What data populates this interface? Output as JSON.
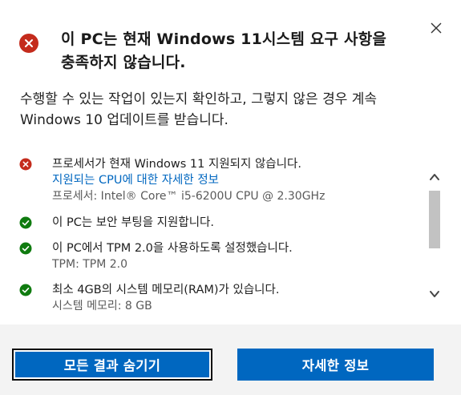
{
  "dialog": {
    "title": "이 PC는 현재 Windows 11시스템 요구 사항을 충족하지 않습니다.",
    "description": "수행할 수 있는 작업이 있는지 확인하고, 그렇지 않은 경우 계속 Windows 10 업데이트를 받습니다."
  },
  "checks": [
    {
      "status": "fail",
      "title": "프로세서가 현재 Windows 11 지원되지 않습니다.",
      "link": "지원되는 CPU에 대한 자세한 정보",
      "detail": "프로세서: Intel® Core™ i5-6200U CPU @ 2.30GHz"
    },
    {
      "status": "pass",
      "title": "이 PC는 보안 부팅을 지원합니다."
    },
    {
      "status": "pass",
      "title": "이 PC에서 TPM 2.0을 사용하도록 설정했습니다.",
      "detail": "TPM: TPM 2.0"
    },
    {
      "status": "pass",
      "title": "최소 4GB의 시스템 메모리(RAM)가 있습니다.",
      "detail": "시스템 메모리: 8 GB"
    }
  ],
  "buttons": {
    "hide_results": "모든 결과 숨기기",
    "more_info": "자세한 정보"
  },
  "icons": {
    "close": "close-icon",
    "header_status": "error-icon",
    "fail": "error-icon",
    "pass": "checkmark-icon",
    "scroll_up": "chevron-up-icon",
    "scroll_down": "chevron-down-icon"
  },
  "colors": {
    "error": "#c42b1c",
    "success": "#0f7b0f",
    "accent": "#0067c0",
    "link": "#0067c0",
    "footer_bg": "#f3f3f3"
  }
}
